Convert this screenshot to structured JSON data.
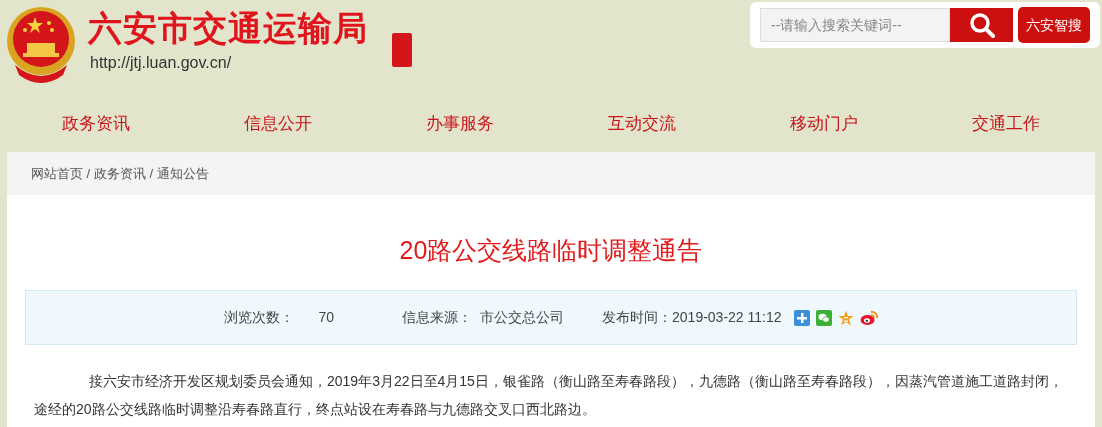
{
  "header": {
    "site_title": "六安市交通运输局",
    "url": "http://jtj.luan.gov.cn/"
  },
  "search": {
    "placeholder": "--请输入搜索关键词--",
    "smart_search_button": "六安智搜"
  },
  "nav": [
    {
      "label": "政务资讯"
    },
    {
      "label": "信息公开"
    },
    {
      "label": "办事服务"
    },
    {
      "label": "互动交流"
    },
    {
      "label": "移动门户"
    },
    {
      "label": "交通工作"
    }
  ],
  "breadcrumb": [
    {
      "label": "网站首页"
    },
    {
      "label": " / "
    },
    {
      "label": "政务资讯"
    },
    {
      "label": " / "
    },
    {
      "label": "通知公告"
    }
  ],
  "article": {
    "title": "20路公交线路临时调整通告",
    "meta": [
      {
        "label": "浏览次数：",
        "value": "70"
      },
      {
        "label": "信息来源：",
        "value": "市公交总公司"
      },
      {
        "label": "发布时间：",
        "value": "2019-03-22 11:12"
      }
    ],
    "share": [
      {
        "kind": "plus"
      },
      {
        "kind": "wechat"
      },
      {
        "kind": "qzone"
      },
      {
        "kind": "weibo"
      }
    ],
    "body": "接六安市经济开发区规划委员会通知，2019年3月22日至4月15日，银雀路（衡山路至寿春路段），九德路（衡山路至寿春路段），因蒸汽管道施工道路封闭，途经的20路公交线路临时调整沿寿春路直行，终点站设在寿春路与九德路交叉口西北路边。"
  }
}
